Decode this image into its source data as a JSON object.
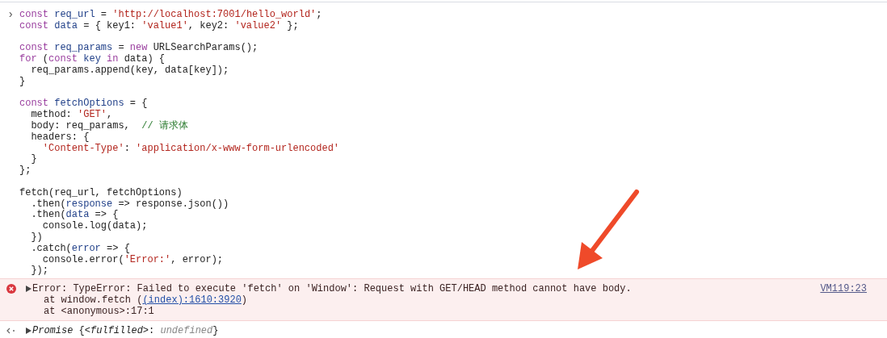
{
  "input": {
    "prompt": "›",
    "lines": [
      {
        "kind": "code",
        "tokens": [
          {
            "kind": "keyword",
            "text": "const "
          },
          {
            "kind": "name",
            "text": "req_url"
          },
          {
            "kind": "plain",
            "text": " = "
          },
          {
            "kind": "string",
            "text": "'http://localhost:7001/hello_world'"
          },
          {
            "kind": "plain",
            "text": ";"
          }
        ]
      },
      {
        "kind": "code",
        "tokens": [
          {
            "kind": "keyword",
            "text": "const "
          },
          {
            "kind": "name",
            "text": "data"
          },
          {
            "kind": "plain",
            "text": " = { key1: "
          },
          {
            "kind": "string",
            "text": "'value1'"
          },
          {
            "kind": "plain",
            "text": ", key2: "
          },
          {
            "kind": "string",
            "text": "'value2'"
          },
          {
            "kind": "plain",
            "text": " };"
          }
        ]
      },
      {
        "kind": "blank"
      },
      {
        "kind": "code",
        "tokens": [
          {
            "kind": "keyword",
            "text": "const "
          },
          {
            "kind": "name",
            "text": "req_params"
          },
          {
            "kind": "plain",
            "text": " = "
          },
          {
            "kind": "keyword",
            "text": "new"
          },
          {
            "kind": "plain",
            "text": " URLSearchParams();"
          }
        ]
      },
      {
        "kind": "code",
        "tokens": [
          {
            "kind": "keyword",
            "text": "for"
          },
          {
            "kind": "plain",
            "text": " ("
          },
          {
            "kind": "keyword",
            "text": "const "
          },
          {
            "kind": "name",
            "text": "key"
          },
          {
            "kind": "keyword",
            "text": " in"
          },
          {
            "kind": "plain",
            "text": " data) {"
          }
        ]
      },
      {
        "kind": "code",
        "tokens": [
          {
            "kind": "plain",
            "text": "  req_params.append(key, data[key]);"
          }
        ]
      },
      {
        "kind": "code",
        "tokens": [
          {
            "kind": "plain",
            "text": "}"
          }
        ]
      },
      {
        "kind": "blank"
      },
      {
        "kind": "code",
        "tokens": [
          {
            "kind": "keyword",
            "text": "const "
          },
          {
            "kind": "name",
            "text": "fetchOptions"
          },
          {
            "kind": "plain",
            "text": " = {"
          }
        ]
      },
      {
        "kind": "code",
        "tokens": [
          {
            "kind": "plain",
            "text": "  method: "
          },
          {
            "kind": "string",
            "text": "'GET'"
          },
          {
            "kind": "plain",
            "text": ","
          }
        ]
      },
      {
        "kind": "code",
        "tokens": [
          {
            "kind": "plain",
            "text": "  body: req_params,  "
          },
          {
            "kind": "comment",
            "text": "// 请求体"
          }
        ]
      },
      {
        "kind": "code",
        "tokens": [
          {
            "kind": "plain",
            "text": "  headers: {"
          }
        ]
      },
      {
        "kind": "code",
        "tokens": [
          {
            "kind": "string",
            "text": "    'Content-Type'"
          },
          {
            "kind": "plain",
            "text": ": "
          },
          {
            "kind": "string",
            "text": "'application/x-www-form-urlencoded'"
          }
        ]
      },
      {
        "kind": "code",
        "tokens": [
          {
            "kind": "plain",
            "text": "  }"
          }
        ]
      },
      {
        "kind": "code",
        "tokens": [
          {
            "kind": "plain",
            "text": "};"
          }
        ]
      },
      {
        "kind": "blank"
      },
      {
        "kind": "code",
        "tokens": [
          {
            "kind": "plain",
            "text": "fetch(req_url, fetchOptions)"
          }
        ]
      },
      {
        "kind": "code",
        "tokens": [
          {
            "kind": "plain",
            "text": "  .then("
          },
          {
            "kind": "name",
            "text": "response"
          },
          {
            "kind": "plain",
            "text": " => response.json())"
          }
        ]
      },
      {
        "kind": "code",
        "tokens": [
          {
            "kind": "plain",
            "text": "  .then("
          },
          {
            "kind": "name",
            "text": "data"
          },
          {
            "kind": "plain",
            "text": " => {"
          }
        ]
      },
      {
        "kind": "code",
        "tokens": [
          {
            "kind": "plain",
            "text": "    console.log(data);"
          }
        ]
      },
      {
        "kind": "code",
        "tokens": [
          {
            "kind": "plain",
            "text": "  })"
          }
        ]
      },
      {
        "kind": "code",
        "tokens": [
          {
            "kind": "plain",
            "text": "  .catch("
          },
          {
            "kind": "name",
            "text": "error"
          },
          {
            "kind": "plain",
            "text": " => {"
          }
        ]
      },
      {
        "kind": "code",
        "tokens": [
          {
            "kind": "plain",
            "text": "    console.error("
          },
          {
            "kind": "string",
            "text": "'Error:'"
          },
          {
            "kind": "plain",
            "text": ", error);"
          }
        ]
      },
      {
        "kind": "code",
        "tokens": [
          {
            "kind": "plain",
            "text": "  });"
          }
        ]
      }
    ]
  },
  "error": {
    "expanded": false,
    "message": "Error: TypeError: Failed to execute 'fetch' on 'Window': Request with GET/HEAD method cannot have body.",
    "source": "VM119:23",
    "stack": [
      {
        "before": "at window.fetch (",
        "link": "(index):1610:3920",
        "after": ")"
      },
      {
        "before": "at <anonymous>:17:1"
      }
    ]
  },
  "result": {
    "expanded": false,
    "tokens": [
      {
        "kind": "italic",
        "text": "Promise"
      },
      {
        "kind": "plain",
        "text": " {"
      },
      {
        "kind": "italic",
        "text": "<fulfilled>"
      },
      {
        "kind": "plain",
        "text": ": "
      },
      {
        "kind": "muted",
        "text": "undefined"
      },
      {
        "kind": "plain",
        "text": "}"
      }
    ]
  }
}
